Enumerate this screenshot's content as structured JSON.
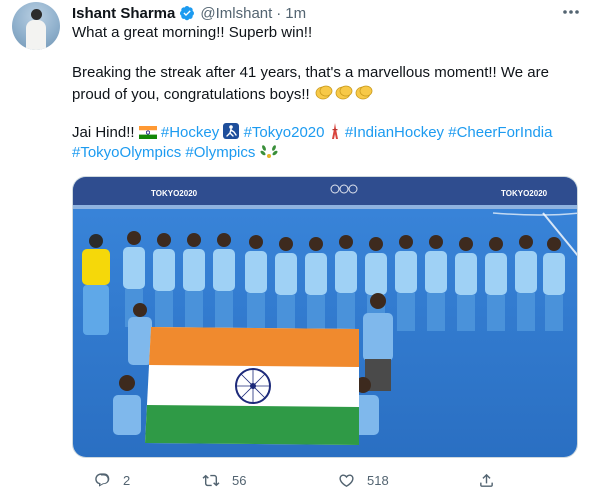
{
  "tweet": {
    "author_name": "Ishant Sharma",
    "handle": "@Imlshant",
    "separator": "·",
    "time": "1m",
    "lines": [
      "What a great morning!! Superb win!!",
      "Breaking the streak after 41 years, that's a marvellous moment!! We are",
      "proud of you, congratulations boys!!",
      "Jai Hind!!"
    ],
    "hashtags": [
      "#Hockey",
      "#Tokyo2020",
      "#IndianHockey",
      "#CheerForIndia",
      "#TokyoOlympics",
      "#Olympics"
    ],
    "image": {
      "banner_left": "TOKYO2020",
      "banner_right": "TOKYO2020"
    }
  },
  "actions": {
    "reply_count": "2",
    "retweet_count": "56",
    "like_count": "518"
  },
  "colors": {
    "link": "#1d9bf0",
    "verified": "#1d9bf0",
    "muted": "#536471",
    "turf": "#2f7fd9"
  },
  "icons": [
    "verified-badge-icon",
    "more-icon",
    "india-flag-emoji",
    "hockey-emoji",
    "tower-emoji",
    "clap-emoji",
    "laurel-emoji",
    "reply-icon",
    "retweet-icon",
    "like-icon",
    "share-icon"
  ]
}
